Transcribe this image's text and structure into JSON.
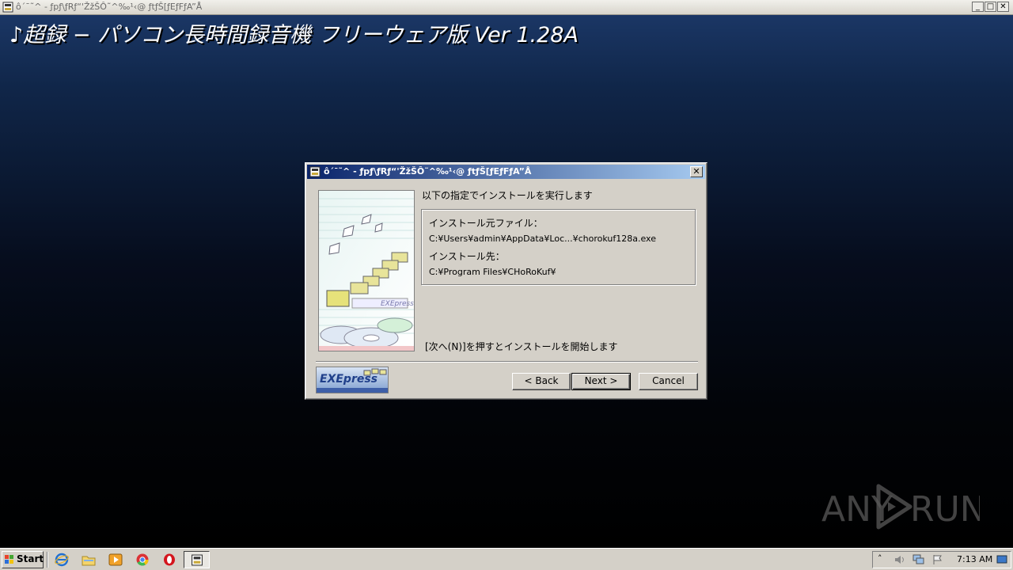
{
  "window": {
    "title": "ô´¯˜^ - ƒpƒ\\ƒRƒ“'ŽžŠÔ˜^‰¹‹@ ƒtƒŠ[ƒEƒFƒA”Å",
    "heading": "♪超録 − パソコン長時間録音機 フリーウェア版 Ver 1.28A",
    "controls": {
      "minimize": "_",
      "maximize": "□",
      "close": "✕"
    }
  },
  "dialog": {
    "title": "ô´¯˜^ - ƒpƒ\\ƒRƒ“'ŽžŠÔ˜^‰¹‹@ ƒtƒŠ[ƒEƒFƒA”Å",
    "close_label": "✕",
    "instruction": "以下の指定でインストールを実行します",
    "info": {
      "source_label": "インストール元ファイル：",
      "source_value": "C:¥Users¥admin¥AppData¥Loc...¥chorokuf128a.exe",
      "dest_label": "インストール先：",
      "dest_value": "C:¥Program Files¥CHoRoKuf¥"
    },
    "note": "[次へ(N)]を押すとインストールを開始します",
    "logo_text": "EXEpress",
    "buttons": {
      "back": "< Back",
      "next": "Next >",
      "cancel": "Cancel"
    }
  },
  "taskbar": {
    "start_label": "Start",
    "clock": "7:13 AM",
    "quick_launch": [
      "ie-icon",
      "folder-icon",
      "media-player-icon",
      "chrome-icon",
      "opera-icon"
    ]
  },
  "watermark": {
    "text": "ANY RUN"
  },
  "colors": {
    "title_gradient_start": "#0a246a",
    "title_gradient_end": "#a6caf0",
    "dialog_face": "#d4d0c8"
  }
}
